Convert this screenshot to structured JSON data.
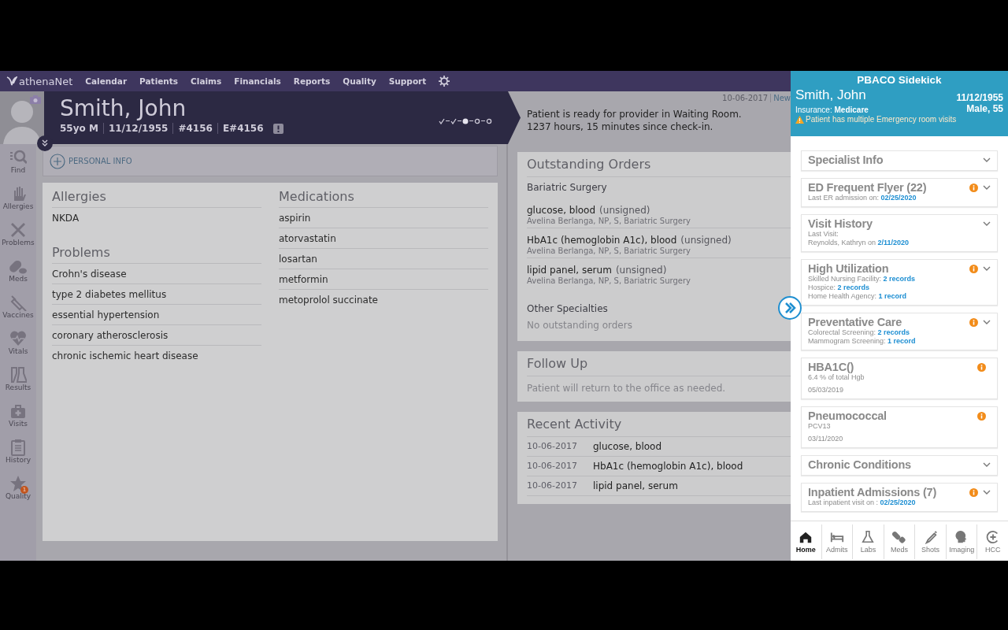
{
  "nav": {
    "logo": "athenaNet",
    "items": [
      "Calendar",
      "Patients",
      "Claims",
      "Financials",
      "Reports",
      "Quality",
      "Support"
    ]
  },
  "patient_header": {
    "name": "Smith, John",
    "details": [
      "55yo M",
      "11/12/1955",
      "#4156",
      "E#4156"
    ],
    "steps": [
      {
        "kind": "done"
      },
      {
        "kind": "done"
      },
      {
        "kind": "current"
      },
      {
        "kind": "pending"
      },
      {
        "kind": "pending"
      }
    ]
  },
  "status": {
    "date": "10-06-2017",
    "link": "New",
    "message": "Patient is ready for provider in Waiting Room.\n1237 hours, 15 minutes since check-in."
  },
  "rail": [
    {
      "kind": "find",
      "label": "Find"
    },
    {
      "kind": "allergies",
      "label": "Allergies"
    },
    {
      "kind": "problems",
      "label": "Problems"
    },
    {
      "kind": "meds",
      "label": "Meds"
    },
    {
      "kind": "vaccines",
      "label": "Vaccines"
    },
    {
      "kind": "vitals",
      "label": "Vitals"
    },
    {
      "kind": "results",
      "label": "Results"
    },
    {
      "kind": "visits",
      "label": "Visits"
    },
    {
      "kind": "history",
      "label": "History"
    },
    {
      "kind": "quality",
      "label": "Quality",
      "badge": "1"
    }
  ],
  "personal_info": "PERSONAL INFO",
  "summary": {
    "left": [
      {
        "title": "Allergies",
        "items": [
          "NKDA"
        ]
      },
      {
        "title": "Problems",
        "items": [
          "Crohn's disease",
          "type 2 diabetes mellitus",
          "essential hypertension",
          "coronary atherosclerosis",
          "chronic ischemic heart disease"
        ]
      }
    ],
    "right": [
      {
        "title": "Medications",
        "items": [
          "aspirin",
          "atorvastatin",
          "losartan",
          "metformin",
          "metoprolol succinate"
        ]
      }
    ]
  },
  "outstanding_orders": {
    "title": "Outstanding Orders",
    "groups": [
      {
        "heading": "Bariatric Surgery",
        "orders": [
          {
            "name": "glucose, blood",
            "status": "(unsigned)",
            "meta": "Avelina Berlanga, NP, S, Bariatric Surgery"
          },
          {
            "name": "HbA1c (hemoglobin A1c), blood",
            "status": "(unsigned)",
            "meta": "Avelina Berlanga, NP, S, Bariatric Surgery"
          },
          {
            "name": "lipid panel, serum",
            "status": "(unsigned)",
            "meta": "Avelina Berlanga, NP, S, Bariatric Surgery"
          }
        ]
      },
      {
        "heading": "Other Specialties",
        "empty": "No outstanding orders"
      }
    ]
  },
  "follow_up": {
    "title": "Follow Up",
    "text": "Patient will return to the office as needed."
  },
  "recent_activity": {
    "title": "Recent Activity",
    "rows": [
      {
        "date": "10-06-2017",
        "item": "glucose, blood"
      },
      {
        "date": "10-06-2017",
        "item": "HbA1c (hemoglobin A1c), blood"
      },
      {
        "date": "10-06-2017",
        "item": "lipid panel, serum"
      }
    ]
  },
  "sidekick": {
    "title": "PBACO Sidekick",
    "patient_name": "Smith, John",
    "dob": "11/12/1955",
    "sex_age": "Male, 55",
    "insurance": "Insurance: **Medicare**",
    "alert": "Patient has multiple Emergency room visits",
    "cards": [
      {
        "title": "Specialist Info",
        "info": false,
        "expandable": true
      },
      {
        "title": "ED Frequent Flyer (22)",
        "info": true,
        "expandable": true,
        "lines": [
          {
            "text": "Last ER admission on: ",
            "link": "02/25/2020"
          }
        ]
      },
      {
        "title": "Visit History",
        "info": false,
        "expandable": true,
        "lines": [
          {
            "text": "Last Visit:"
          },
          {
            "text": "Reynolds, Kathryn on ",
            "link": "2/11/2020"
          }
        ]
      },
      {
        "title": "High Utilization",
        "info": true,
        "expandable": true,
        "lines": [
          {
            "text": "Skilled Nursing Facility: ",
            "link": "2 records"
          },
          {
            "text": "Hospice: ",
            "link": "2 records"
          },
          {
            "text": "Home Health Agency: ",
            "link": "1 record"
          }
        ]
      },
      {
        "title": "Preventative Care",
        "info": true,
        "expandable": true,
        "lines": [
          {
            "text": "Colorectal Screening: ",
            "link": "2 records"
          },
          {
            "text": "Mammogram Screening: ",
            "link": "1 record"
          }
        ]
      },
      {
        "title": "HBA1C()",
        "info": true,
        "expandable": false,
        "lines": [
          {
            "text": "6.4 % of total Hgb"
          },
          {
            "text": "05/03/2019"
          }
        ]
      },
      {
        "title": "Pneumococcal",
        "info": true,
        "expandable": false,
        "lines": [
          {
            "text": "PCV13"
          },
          {
            "text": "03/11/2020"
          }
        ]
      },
      {
        "title": "Chronic Conditions",
        "info": false,
        "expandable": true
      },
      {
        "title": "Inpatient Admissions (7)",
        "info": true,
        "expandable": true,
        "lines": [
          {
            "text": "Last inpatient visit on : ",
            "link": "02/25/2020"
          }
        ]
      }
    ],
    "tabs": [
      {
        "kind": "home",
        "label": "Home",
        "selected": true
      },
      {
        "kind": "admits",
        "label": "Admits",
        "selected": false
      },
      {
        "kind": "labs",
        "label": "Labs",
        "selected": false
      },
      {
        "kind": "meds",
        "label": "Meds",
        "selected": false
      },
      {
        "kind": "shots",
        "label": "Shots",
        "selected": false
      },
      {
        "kind": "imaging",
        "label": "Imaging",
        "selected": false
      },
      {
        "kind": "hcc",
        "label": "HCC",
        "selected": false
      }
    ]
  }
}
